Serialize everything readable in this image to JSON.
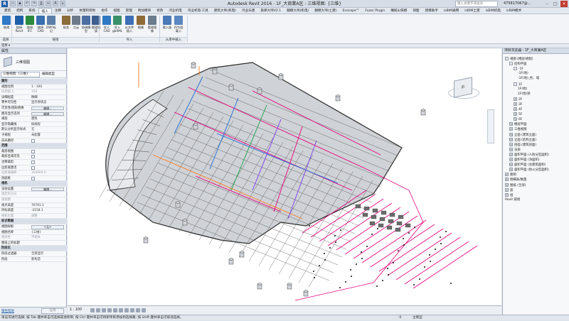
{
  "titlebar": {
    "logo": "R",
    "title": "Autodesk Revit 2016 -    1F_大商業A区 - 三维视图: {三维}",
    "search_placeholder": "键入关键字或短语",
    "user": "475817067@..."
  },
  "tabs": [
    "建筑",
    "结构",
    "系统",
    "插入",
    "注释",
    "分析",
    "体量和场地",
    "协作",
    "视图",
    "管理",
    "附加模块",
    "修改",
    "鸿业机电",
    "鸿业机电·工具",
    "建筑大师(机电)",
    "鸿业乐建",
    "族库大师V2.1",
    "翻模大师(机电)",
    "翻模大师(土建)",
    "Enscape™",
    "Fuzor Plugin",
    "橄榄山快模",
    "快图",
    "建模助手",
    "isBIM通用",
    "isBIM土建",
    "isBIM机电",
    "isBIM模术"
  ],
  "active_tab": "插入",
  "ribbon": {
    "buttons": [
      "修改",
      "链接Revit",
      "链接IFC",
      "链接CAD",
      "DWF标记",
      "贴花",
      "点云",
      "协调模型",
      "管理链接",
      "导入CAD",
      "导入gbXML",
      "从文件插入",
      "图像",
      "管理图像",
      "载入族",
      "作为组载入"
    ],
    "groups": [
      "选择",
      "链接",
      "导入",
      "从库中载入"
    ]
  },
  "selectbar": {
    "label": "选择 ▾"
  },
  "properties": {
    "title": "属性",
    "type_name": "三维视图",
    "instance": "三维视图: {三维}",
    "edit_type": "编辑类型",
    "rows": [
      {
        "kind": "group",
        "k": "图形"
      },
      {
        "k": "视图比例",
        "v": "1 : 100"
      },
      {
        "k": "比例值 1:",
        "v": "100",
        "dim": true
      },
      {
        "k": "详细程度",
        "v": "精细"
      },
      {
        "k": "零件可见性",
        "v": "显示原状态"
      },
      {
        "k": "可见性/图形替换",
        "btn": "编辑..."
      },
      {
        "k": "图形显示选项",
        "btn": "编辑..."
      },
      {
        "k": "规程",
        "v": "建筑"
      },
      {
        "k": "显示隐藏线",
        "v": "按规程"
      },
      {
        "k": "默认分析显示样式",
        "v": "无"
      },
      {
        "k": "子规程",
        "v": "未配置"
      },
      {
        "k": "日光路径",
        "box": true
      },
      {
        "kind": "group",
        "k": "范围"
      },
      {
        "k": "裁剪视图",
        "box": true
      },
      {
        "k": "裁剪区域可见",
        "box": true
      },
      {
        "k": "注释裁剪",
        "box": true
      },
      {
        "k": "远剪裁激活",
        "box": true
      },
      {
        "k": "远剪裁偏移",
        "v": "304800.0",
        "dim": true
      },
      {
        "k": "剖面框",
        "box": true
      },
      {
        "kind": "group",
        "k": "相机"
      },
      {
        "k": "渲染设置",
        "btn": "编辑..."
      },
      {
        "k": "锁定的方向",
        "dim": true
      },
      {
        "k": "透视图",
        "dim": true
      },
      {
        "k": "视点高度",
        "v": "70761.1"
      },
      {
        "k": "目标高度",
        "v": "-2158.1"
      },
      {
        "k": "相机位置",
        "v": "调整",
        "dim": true
      },
      {
        "kind": "group",
        "k": "标识数据"
      },
      {
        "k": "视图样板",
        "btn": "<无>"
      },
      {
        "k": "视图名称",
        "v": "{三维}"
      },
      {
        "k": "相关性",
        "v": "不相关",
        "dim": true
      },
      {
        "k": "图纸上的标题",
        "v": ""
      },
      {
        "kind": "group",
        "k": "阶段化"
      },
      {
        "k": "阶段过滤器",
        "v": "全部显示"
      },
      {
        "k": "阶段",
        "v": "新构造"
      }
    ],
    "help": "属性帮助",
    "apply": "应用"
  },
  "canvas": {
    "viewcube_face": "前",
    "pipe_colors": [
      "#e6007e",
      "#1e6bd6",
      "#ff7a1a",
      "#16a34a",
      "#7c3aed"
    ]
  },
  "viewbar": {
    "scale": "1 : 100"
  },
  "browser": {
    "title": "项目浏览器 - 1F_大商業A区",
    "rows": [
      {
        "t": "视图 (楼层/规程)",
        "lvl": 0,
        "tog": "-"
      },
      {
        "t": "结构平面",
        "lvl": 1,
        "tog": "-"
      },
      {
        "t": "-1F",
        "lvl": 2,
        "tog": "-"
      },
      {
        "t": "-1F(地)",
        "lvl": 3
      },
      {
        "t": "-1F(地)_柱、墙",
        "lvl": 3
      },
      {
        "t": "1F",
        "lvl": 2,
        "tog": "-"
      },
      {
        "t": "1F(地)",
        "lvl": 3
      },
      {
        "t": "1F(地)梁",
        "lvl": 3
      },
      {
        "t": "2F",
        "lvl": 2,
        "tog": "+"
      },
      {
        "t": "3F",
        "lvl": 2,
        "tog": "+"
      },
      {
        "t": "4F",
        "lvl": 2,
        "tog": "+"
      },
      {
        "t": "5F",
        "lvl": 2,
        "tog": "+"
      },
      {
        "t": "6F",
        "lvl": 2,
        "tog": "+"
      },
      {
        "t": "楼层平面",
        "lvl": 1,
        "tog": "+"
      },
      {
        "t": "三维视图",
        "lvl": 1,
        "tog": "+"
      },
      {
        "t": "立面 (建筑立面)",
        "lvl": 1,
        "tog": "+"
      },
      {
        "t": "立面 (结构立面)",
        "lvl": 1,
        "tog": "+"
      },
      {
        "t": "剖面 (建筑剖面)",
        "lvl": 1,
        "tog": "+"
      },
      {
        "t": "渲染",
        "lvl": 1,
        "tog": "+"
      },
      {
        "t": "面积平面 (人防分区面积)",
        "lvl": 1,
        "tog": "+"
      },
      {
        "t": "面积平面 (净面积)",
        "lvl": 1,
        "tog": "+"
      },
      {
        "t": "面积平面 (总建筑面积)",
        "lvl": 1,
        "tog": "+"
      },
      {
        "t": "面积平面 (防火分区面积)",
        "lvl": 1,
        "tog": "+"
      },
      {
        "t": "图例",
        "lvl": 0,
        "tog": "+"
      },
      {
        "t": "明细表/数量",
        "lvl": 0,
        "tog": "+"
      },
      {
        "t": "图纸 (全部)",
        "lvl": 0,
        "tog": "+"
      },
      {
        "t": "族",
        "lvl": 0,
        "tog": "+"
      },
      {
        "t": "组",
        "lvl": 0,
        "tog": "+"
      },
      {
        "t": "Revit 链接",
        "lvl": 0,
        "tog": ""
      }
    ]
  },
  "status": {
    "text": "单击可进行选择; 按 Tab 键并单击可选择其他项目; 按 Ctrl 键并单击可将新项目添加到选择集; 按 Shift 键并单击可取消选择。",
    "coord": ":0",
    "model": "主模型"
  }
}
